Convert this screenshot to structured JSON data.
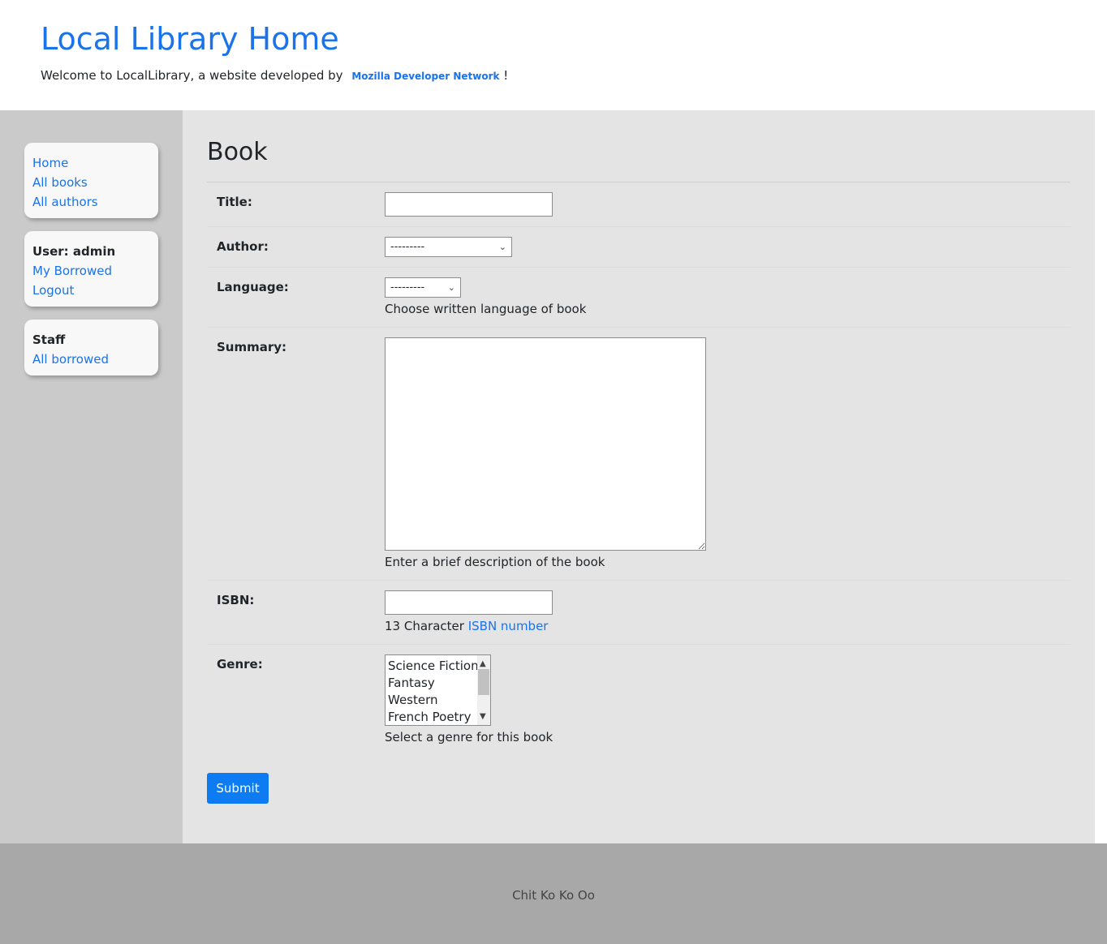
{
  "header": {
    "title": "Local Library Home",
    "welcome_text": "Welcome to LocalLibrary, a website developed by",
    "mdn_link": "Mozilla Developer Network",
    "exclaim": "!"
  },
  "sidebar": {
    "nav": [
      "Home",
      "All books",
      "All authors"
    ],
    "user_label": "User: admin",
    "user_links": [
      "My Borrowed",
      "Logout"
    ],
    "staff_label": "Staff",
    "staff_links": [
      "All borrowed"
    ]
  },
  "form": {
    "page_title": "Book",
    "title_label": "Title:",
    "title_value": "",
    "author_label": "Author:",
    "author_selected": "---------",
    "language_label": "Language:",
    "language_selected": "---------",
    "language_help": "Choose written language of book",
    "summary_label": "Summary:",
    "summary_value": "",
    "summary_help": "Enter a brief description of the book",
    "isbn_label": "ISBN:",
    "isbn_value": "",
    "isbn_help_prefix": "13 Character",
    "isbn_help_link": "ISBN number",
    "genre_label": "Genre:",
    "genre_options": [
      "Science Fiction",
      "Fantasy",
      "Western",
      "French Poetry"
    ],
    "genre_help": "Select a genre for this book",
    "submit_label": "Submit"
  },
  "footer": {
    "text": "Chit Ko Ko Oo"
  },
  "colors": {
    "link": "#1a73e8",
    "button": "#0d7bf2",
    "sidebar_bg": "#cacaca",
    "content_bg": "#e4e4e4",
    "footer_bg": "#a8a8a8"
  }
}
